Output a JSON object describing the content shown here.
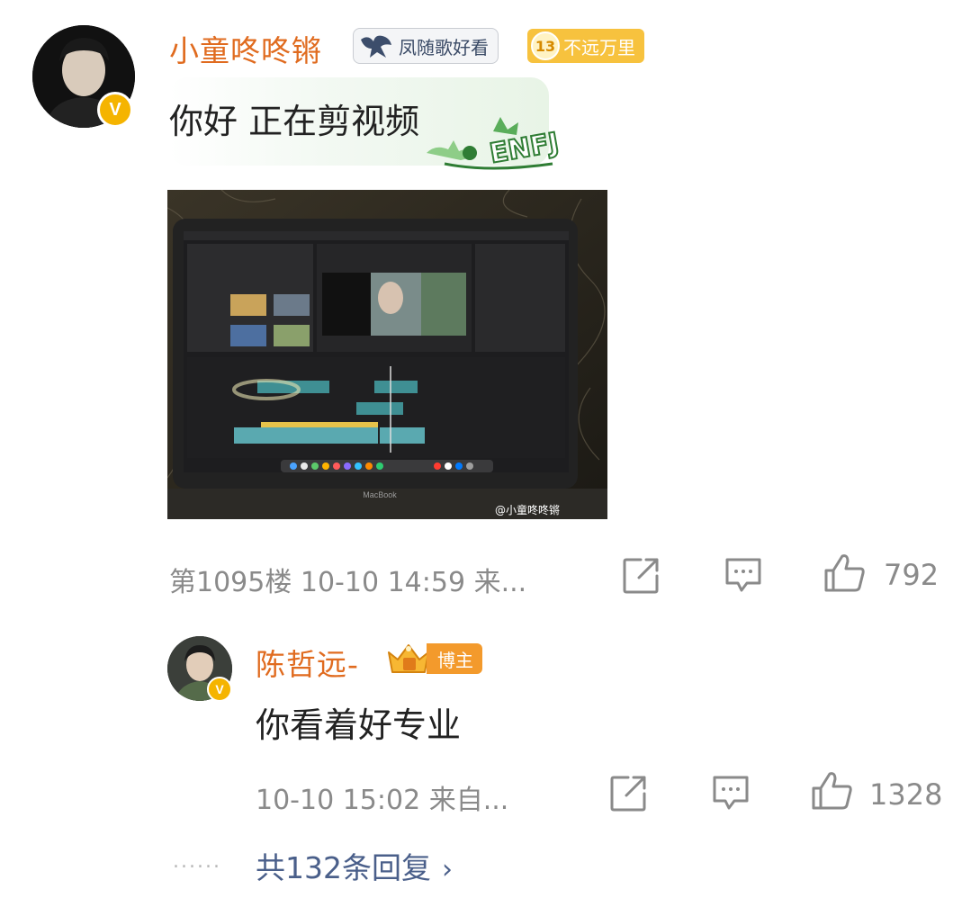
{
  "comment": {
    "username": "小童咚咚锵",
    "fan_badge": "凤随歌好看",
    "level": "13",
    "level_badge_text": "不远万里",
    "text": "你好 正在剪视频",
    "bubble_sticker_text": "ENFJ",
    "image_watermark": "@小童咚咚锵",
    "laptop_brand": "MacBook",
    "meta": "第1095楼  10-10 14:59  来...",
    "like_count": "792"
  },
  "reply": {
    "username": "陈哲远-",
    "role_badge": "博主",
    "text": "你看着好专业",
    "meta": "10-10 15:02  来自...",
    "like_count": "1328"
  },
  "more_replies": {
    "dots": "......",
    "label": "共132条回复"
  },
  "colors": {
    "username": "#e06b1f",
    "meta": "#8a8a8a",
    "link": "#4a5f8a",
    "verified": "#f5b400"
  },
  "icons": [
    "verified-icon",
    "share-icon",
    "comment-icon",
    "like-icon",
    "chevron-right-icon"
  ]
}
